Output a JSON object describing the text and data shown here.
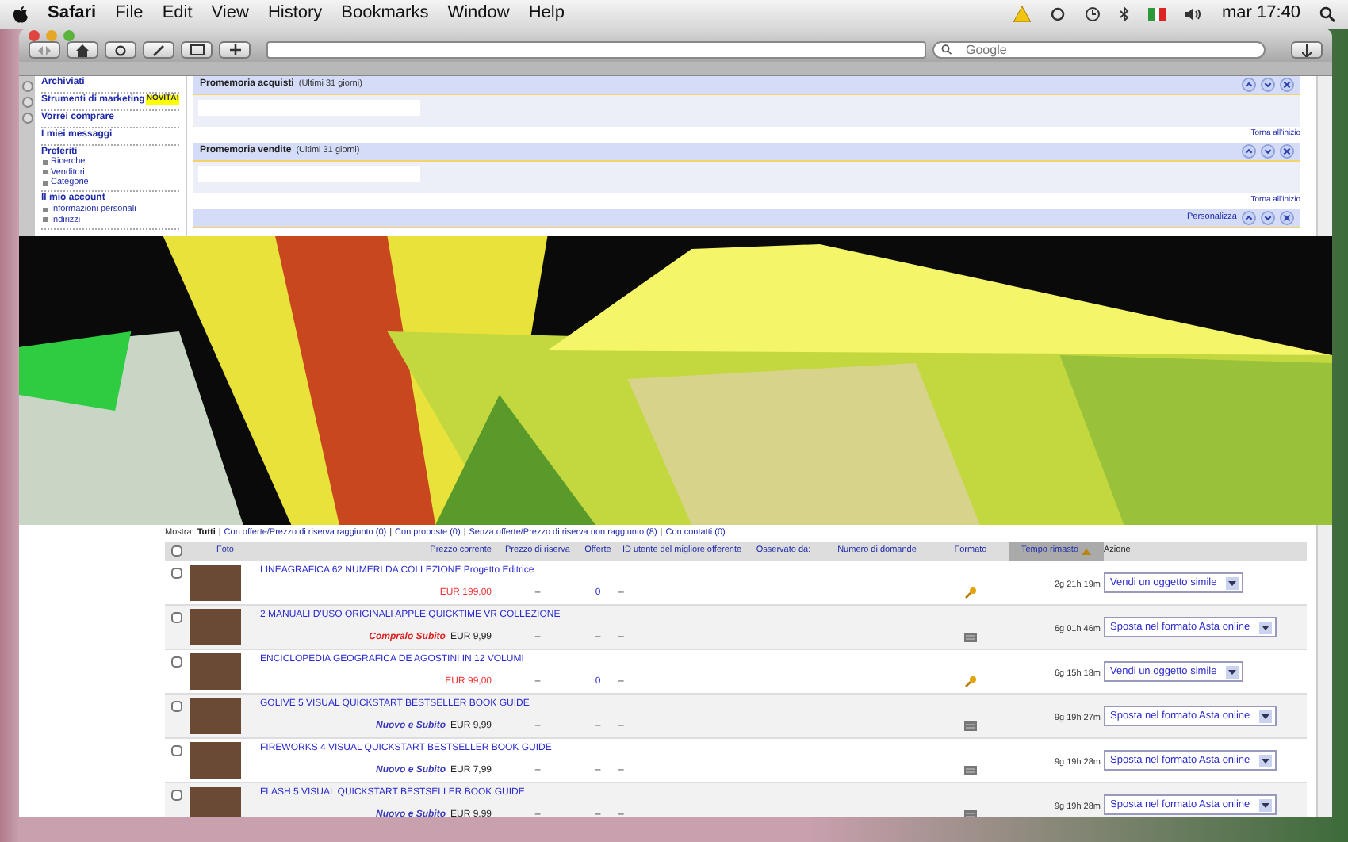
{
  "menubar": {
    "app": "Safari",
    "items": [
      "File",
      "Edit",
      "View",
      "History",
      "Bookmarks",
      "Window",
      "Help"
    ],
    "clock": "mar 17:40"
  },
  "toolbar": {
    "search": {
      "placeholder": "Google"
    }
  },
  "sidebar": {
    "groups": [
      {
        "title": "Archiviati"
      },
      {
        "title": "Strumenti di marketing",
        "badge": "NOVITÀ!"
      },
      {
        "title": "Vorrei comprare"
      },
      {
        "title": "I miei messaggi"
      },
      {
        "title": "Preferiti",
        "links": [
          "Ricerche",
          "Venditori",
          "Categorie"
        ]
      },
      {
        "title": "Il mio account",
        "links": [
          "Informazioni personali",
          "Indirizzi"
        ]
      }
    ]
  },
  "panels": [
    {
      "title": "Promemoria acquisti",
      "note": "(Ultimi 31 giorni)",
      "footer": "Torna all'inizio"
    },
    {
      "title": "Promemoria vendite",
      "note": "(Ultimi 31 giorni)",
      "footer": "Torna all'inizio"
    },
    {
      "link": "Personalizza"
    }
  ],
  "filter": {
    "label": "Mostra:",
    "separator": "|",
    "options": [
      {
        "label": "Tutti",
        "selected": true
      },
      {
        "label": "Con offerte/Prezzo di riserva raggiunto (0)",
        "selected": false
      },
      {
        "label": "Con proposte (0)",
        "selected": false
      },
      {
        "label": "Senza offerte/Prezzo di riserva non raggiunto (8)",
        "selected": false
      },
      {
        "label": "Con contatti (0)",
        "selected": false
      }
    ]
  },
  "table": {
    "select_all": {
      "checked": false
    },
    "columns": [
      {
        "label": "Foto",
        "sorted": false
      },
      {
        "label": "Prezzo corrente",
        "sorted": false
      },
      {
        "label": "Prezzo di riserva",
        "sorted": false
      },
      {
        "label": "Offerte",
        "sorted": false
      },
      {
        "label": "ID utente del migliore offerente",
        "sorted": false
      },
      {
        "label": "Osservato da:",
        "sorted": false
      },
      {
        "label": "Numero di domande",
        "sorted": false
      },
      {
        "label": "Formato",
        "sorted": false
      },
      {
        "label": "Tempo rimasto",
        "sorted": true
      },
      {
        "label": "Azione",
        "sorted": false
      }
    ],
    "rows": [
      {
        "checked": false,
        "title": "LINEAGRAFICA 62 NUMERI DA COLLEZIONE Progetto Editrice",
        "price": "EUR 199,00",
        "has_bids": true,
        "reserve": "–",
        "offers": "0",
        "bidder": "–",
        "kind": "auction",
        "time": "2g 21h 19m",
        "action": "Vendi un oggetto simile"
      },
      {
        "checked": false,
        "title": "2 MANUALI D'USO ORIGINALI APPLE QUICKTIME VR COLLEZIONE",
        "badge": "Compralo Subito",
        "price": "EUR 9,99",
        "has_bids": false,
        "reserve": "–",
        "offers": "–",
        "bidder": "–",
        "kind": "fixed",
        "time": "6g 01h 46m",
        "action": "Sposta nel formato Asta online"
      },
      {
        "checked": false,
        "title": "ENCICLOPEDIA GEOGRAFICA DE AGOSTINI IN 12 VOLUMI",
        "price": "EUR 99,00",
        "has_bids": true,
        "reserve": "–",
        "offers": "0",
        "bidder": "–",
        "kind": "auction",
        "time": "6g 15h 18m",
        "action": "Vendi un oggetto simile"
      },
      {
        "checked": false,
        "title": "GOLIVE 5 VISUAL QUICKSTART BESTSELLER BOOK GUIDE",
        "badge": "Nuovo e Subito",
        "price": "EUR 9,99",
        "has_bids": false,
        "reserve": "–",
        "offers": "–",
        "bidder": "–",
        "kind": "fixed",
        "time": "9g 19h 27m",
        "action": "Sposta nel formato Asta online"
      },
      {
        "checked": false,
        "title": "FIREWORKS 4 VISUAL QUICKSTART BESTSELLER BOOK GUIDE",
        "badge": "Nuovo e Subito",
        "price": "EUR 7,99",
        "has_bids": false,
        "reserve": "–",
        "offers": "–",
        "bidder": "–",
        "kind": "fixed",
        "time": "9g 19h 28m",
        "action": "Sposta nel formato Asta online"
      },
      {
        "checked": false,
        "title": "FLASH 5 VISUAL QUICKSTART BESTSELLER BOOK GUIDE",
        "badge": "Nuovo e Subito",
        "price": "EUR 9,99",
        "has_bids": false,
        "reserve": "–",
        "offers": "–",
        "bidder": "–",
        "kind": "fixed",
        "time": "9g 19h 28m",
        "action": "Sposta nel formato Asta online"
      }
    ]
  }
}
